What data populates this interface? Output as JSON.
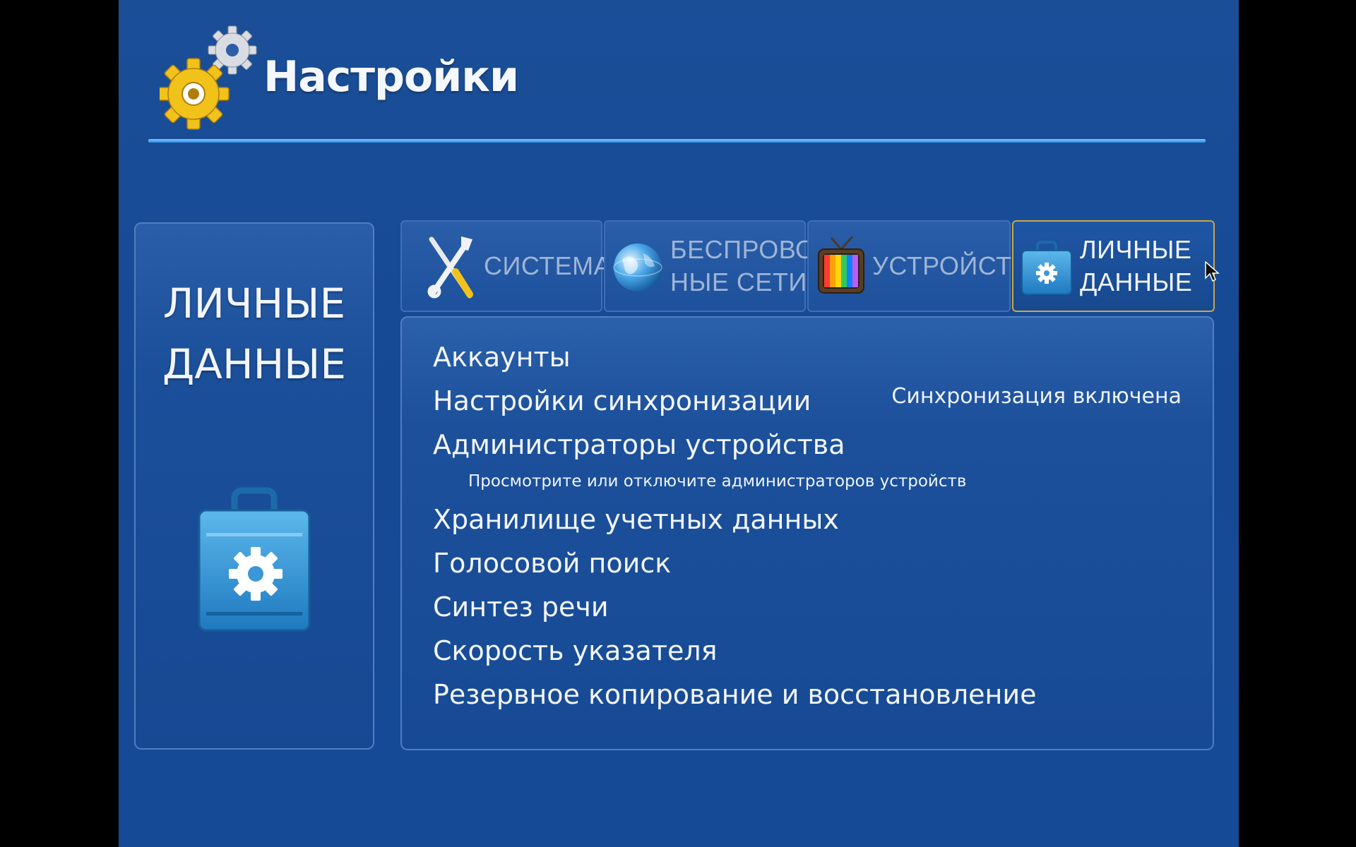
{
  "header": {
    "title": "Настройки",
    "icon": "gears-icon"
  },
  "side_panel": {
    "title_line1": "ЛИЧНЫЕ",
    "title_line2": "ДАННЫЕ",
    "icon": "briefcase-gear-icon"
  },
  "tabs": [
    {
      "line1": "СИСТЕМА",
      "line2": "",
      "icon": "tools-icon",
      "active": false
    },
    {
      "line1": "БЕСПРОВОД",
      "line2": "НЫЕ СЕТИ",
      "icon": "globe-icon",
      "active": false
    },
    {
      "line1": "УСТРОЙСТВО",
      "line2": "",
      "icon": "tv-icon",
      "active": false
    },
    {
      "line1": "ЛИЧНЫЕ",
      "line2": "ДАННЫЕ",
      "icon": "briefcase-gear-icon",
      "active": true
    }
  ],
  "menu": {
    "accounts": "Аккаунты",
    "sync": "Настройки синхронизации",
    "sync_status": "Синхронизация включена",
    "device_admins": "Администраторы устройства",
    "device_admins_sub": "Просмотрите или отключите администраторов устройств",
    "credentials": "Хранилище учетных данных",
    "voice_search": "Голосовой поиск",
    "tts": "Синтез речи",
    "pointer_speed": "Скорость указателя",
    "backup": "Резервное копирование и восстановление"
  },
  "colors": {
    "background": "#1a4f98",
    "accent_line": "#4aa8ff",
    "active_tab_border": "#c8a74a"
  }
}
